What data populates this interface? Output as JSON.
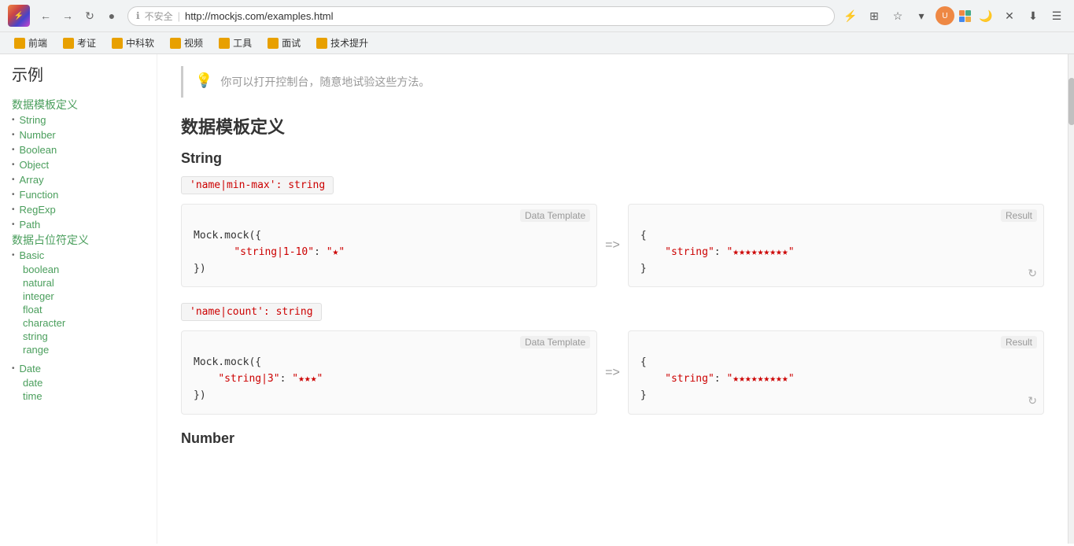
{
  "browser": {
    "url": "http://mockjs.com/examples.html",
    "insecure_label": "不安全",
    "separator": "|"
  },
  "bookmarks": [
    {
      "label": "前端",
      "color": "bm-yellow"
    },
    {
      "label": "考证",
      "color": "bm-yellow"
    },
    {
      "label": "中科软",
      "color": "bm-yellow"
    },
    {
      "label": "视频",
      "color": "bm-yellow"
    },
    {
      "label": "工具",
      "color": "bm-yellow"
    },
    {
      "label": "面试",
      "color": "bm-yellow"
    },
    {
      "label": "技术提升",
      "color": "bm-yellow"
    }
  ],
  "page": {
    "title": "示例"
  },
  "sidebar": {
    "section1_title": "数据模板定义",
    "section1_items": [
      {
        "label": "String"
      },
      {
        "label": "Number"
      },
      {
        "label": "Boolean"
      },
      {
        "label": "Object"
      },
      {
        "label": "Array"
      },
      {
        "label": "Function"
      },
      {
        "label": "RegExp"
      },
      {
        "label": "Path"
      }
    ],
    "section2_title": "数据占位符定义",
    "section2_items": [
      {
        "label": "Basic"
      }
    ],
    "section2_sub_items": [
      {
        "label": "boolean"
      },
      {
        "label": "natural"
      },
      {
        "label": "integer"
      },
      {
        "label": "float"
      },
      {
        "label": "character"
      },
      {
        "label": "string"
      },
      {
        "label": "range"
      }
    ],
    "section3_items": [
      {
        "label": "Date"
      }
    ],
    "section3_sub_items": [
      {
        "label": "date"
      },
      {
        "label": "time"
      }
    ]
  },
  "main": {
    "hint_text": "你可以打开控制台，随意地试验这些方法。",
    "section_title": "数据模板定义",
    "string_title": "String",
    "string_badge1": "'name|min-max': string",
    "string_badge2": "'name|count': string",
    "number_title": "Number",
    "demo1": {
      "template_label": "Data Template",
      "result_label": "Result",
      "template_line1": "Mock.mock({",
      "template_line2": "    \"string|1-10\": \"★\"",
      "template_line3": "})",
      "result_line1": "{",
      "result_line2": "    \"string\": \"★★★★★★★★★\"",
      "result_line3": "}"
    },
    "demo2": {
      "template_label": "Data Template",
      "result_label": "Result",
      "template_line1": "Mock.mock({",
      "template_line2": "    \"string|3\": \"★★★\"",
      "template_line3": "})",
      "result_line1": "{",
      "result_line2": "    \"string\": \"★★★★★★★★★\"",
      "result_line3": "}"
    }
  }
}
